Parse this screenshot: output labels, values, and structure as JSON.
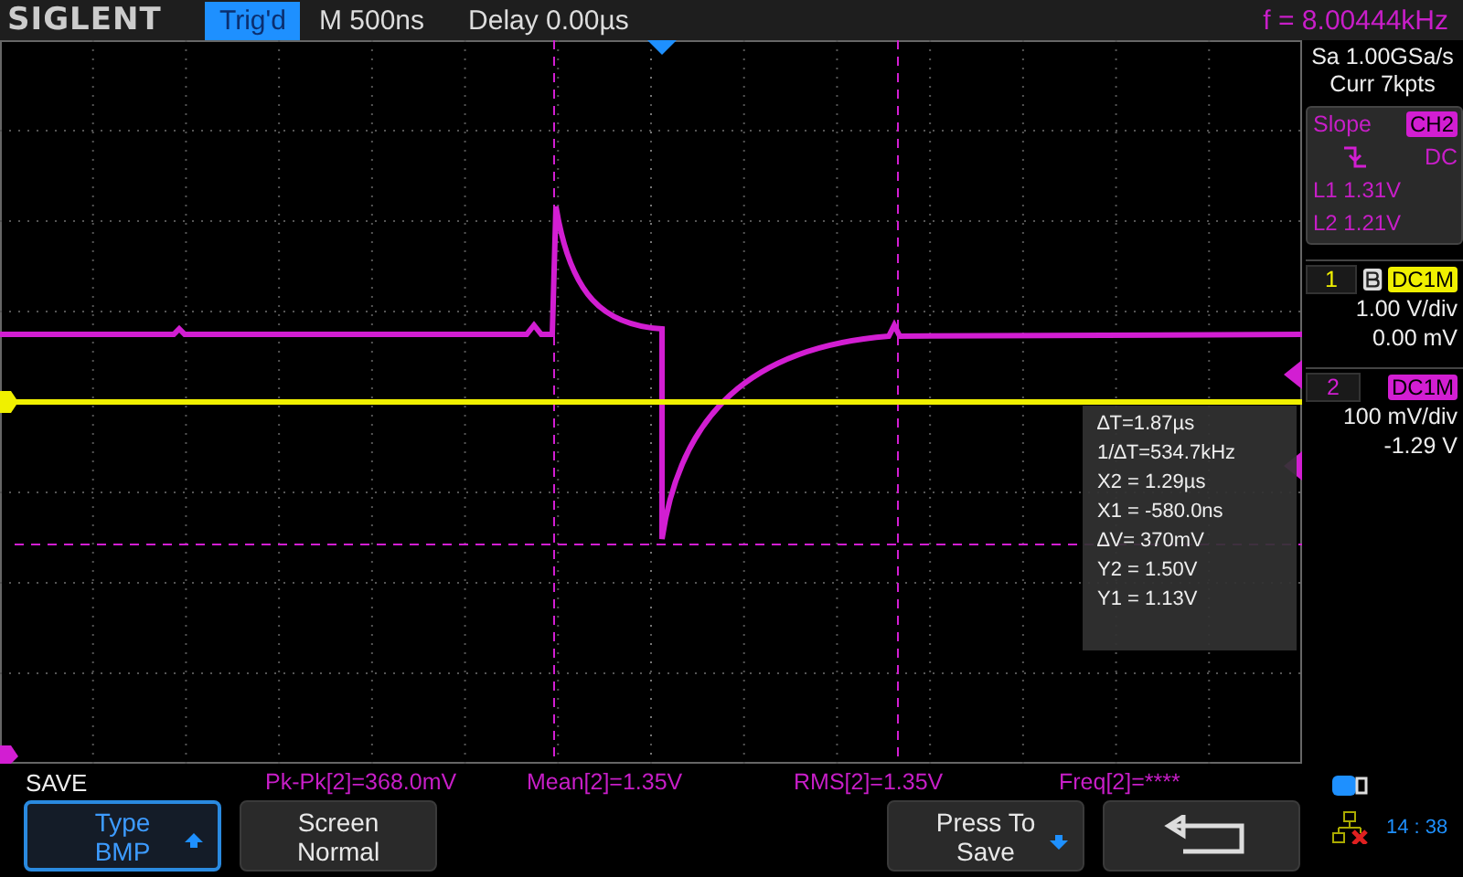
{
  "header": {
    "brand": "SIGLENT",
    "trigger_status": "Trig'd",
    "timebase": "M 500ns",
    "delay": "Delay 0.00µs",
    "frequency": "f = 8.00444kHz"
  },
  "acquisition": {
    "sample_rate": "Sa 1.00GSa/s",
    "memory": "Curr 7kpts"
  },
  "trigger": {
    "type": "Slope",
    "source": "CH2",
    "coupling": "DC",
    "level_1": "L1  1.31V",
    "level_2": "L2  1.21V"
  },
  "channels": [
    {
      "number": "1",
      "coupling": "DC1M",
      "bandwidth_limit": true,
      "scale": "1.00 V/div",
      "offset": "0.00 mV",
      "color": "#f0f000"
    },
    {
      "number": "2",
      "coupling": "DC1M",
      "bandwidth_limit": false,
      "scale": "100 mV/div",
      "offset": "-1.29 V",
      "color": "#d21ed2"
    }
  ],
  "cursor_readout": [
    "∆T=1.87µs",
    "1/∆T=534.7kHz",
    "X2 = 1.29µs",
    "X1 = -580.0ns",
    "∆V= 370mV",
    "Y2 = 1.50V",
    "Y1 = 1.13V"
  ],
  "menu_title": "SAVE",
  "measurements": [
    "Pk-Pk[2]=368.0mV",
    "Mean[2]=1.35V",
    "RMS[2]=1.35V",
    "Freq[2]=****"
  ],
  "softkeys": [
    {
      "kind": "option",
      "line1": "Type",
      "line2": "BMP",
      "selected": true
    },
    {
      "kind": "plain",
      "line1": "Screen",
      "line2": "Normal",
      "selected": false
    },
    {
      "kind": "action",
      "line1": "Press To",
      "line2": "Save",
      "selected": false
    },
    {
      "kind": "back",
      "selected": false
    }
  ],
  "status": {
    "time": "14 : 38"
  }
}
